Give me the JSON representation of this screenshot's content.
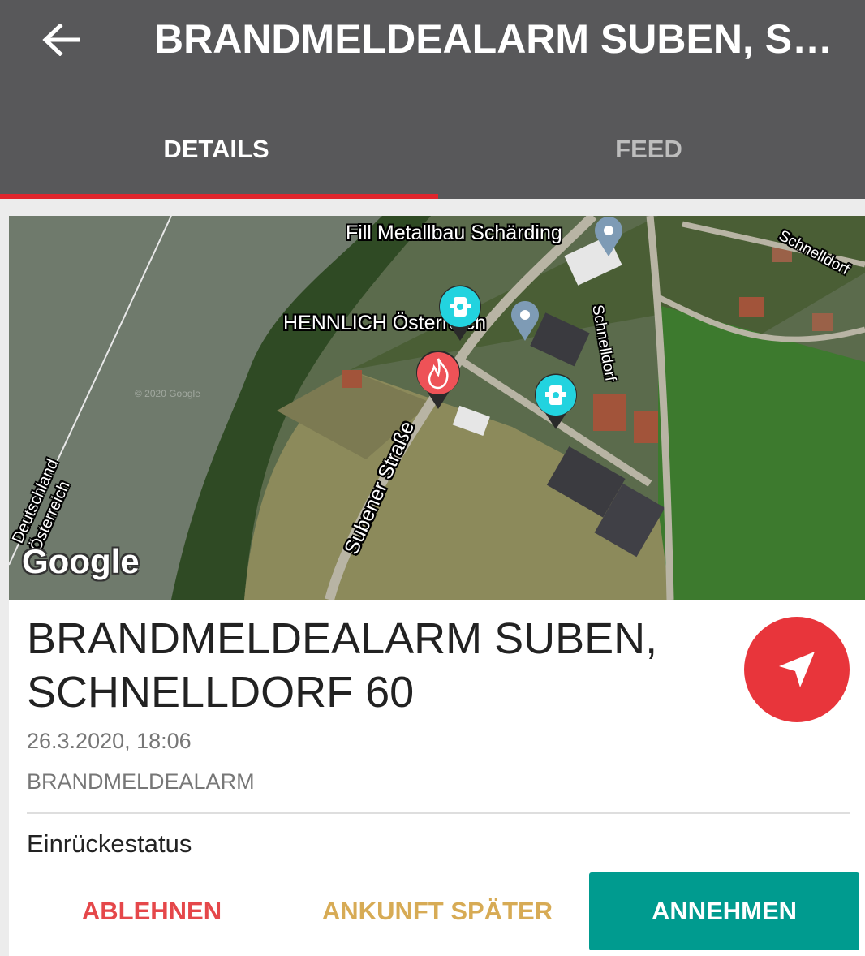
{
  "header": {
    "title": "BRANDMELDEALARM SUBEN, SCHNELLDORF 60",
    "back_icon": "arrow-left-icon"
  },
  "tabs": [
    {
      "label": "DETAILS",
      "active": true
    },
    {
      "label": "FEED",
      "active": false
    }
  ],
  "map": {
    "labels": {
      "poi_fill": "Fill Metallbau Schärding",
      "poi_hennlich": "HENNLICH Österreich",
      "road_schnelldorf_1": "Schnelldorf",
      "road_schnelldorf_2": "Schnelldorf",
      "road_subener": "Subener Straße",
      "border_de": "Deutschland",
      "border_at": "Österreich",
      "watermark": "© 2020 Google"
    },
    "logo": "Google",
    "markers": [
      "fire-marker-icon",
      "hydrant-marker-icon",
      "hydrant-marker-icon",
      "poi-pin-icon",
      "poi-pin-icon"
    ]
  },
  "incident": {
    "title": "BRANDMELDEALARM SUBEN, SCHNELLDORF 60",
    "datetime": "26.3.2020, 18:06",
    "type": "BRANDMELDEALARM",
    "navigate_icon": "navigation-arrow-icon"
  },
  "response": {
    "label": "Einrückestatus",
    "decline": "ABLEHNEN",
    "later": "ANKUNFT SPÄTER",
    "accept": "ANNEHMEN"
  },
  "colors": {
    "appbar": "#58585a",
    "accent_red": "#e0252d",
    "fab": "#e8353b",
    "decline": "#e5474a",
    "later": "#d7ab55",
    "accept": "#009b8f",
    "hydrant": "#22d3df"
  }
}
